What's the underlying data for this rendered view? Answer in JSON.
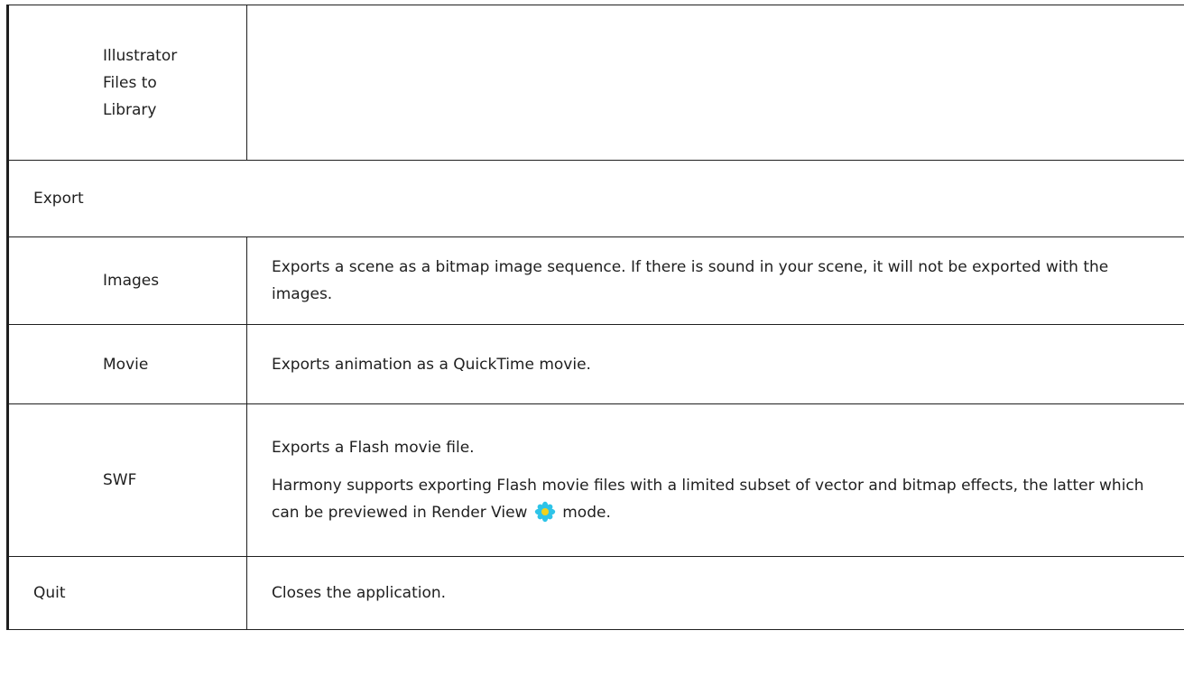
{
  "rows": [
    {
      "label": "Illustrator Files to Library",
      "description": ""
    },
    {
      "label": "Export"
    },
    {
      "label": "Images",
      "description": "Exports a scene as a bitmap image sequence. If there is sound in your scene, it will not be exported with the images."
    },
    {
      "label": "Movie",
      "description": "Exports animation as a QuickTime movie."
    },
    {
      "label": "SWF",
      "description_1": "Exports a Flash movie file.",
      "description_2_before": "Harmony supports exporting Flash movie files with a limited subset of vector and bitmap effects, the latter which can be previewed in Render View",
      "description_2_after": "mode.",
      "icon": "render-view-icon"
    },
    {
      "label": "Quit",
      "description": "Closes the application."
    }
  ],
  "colors": {
    "border": "#1f1f1f",
    "icon_petal": "#2ec4e8",
    "icon_center": "#f2d21b"
  }
}
